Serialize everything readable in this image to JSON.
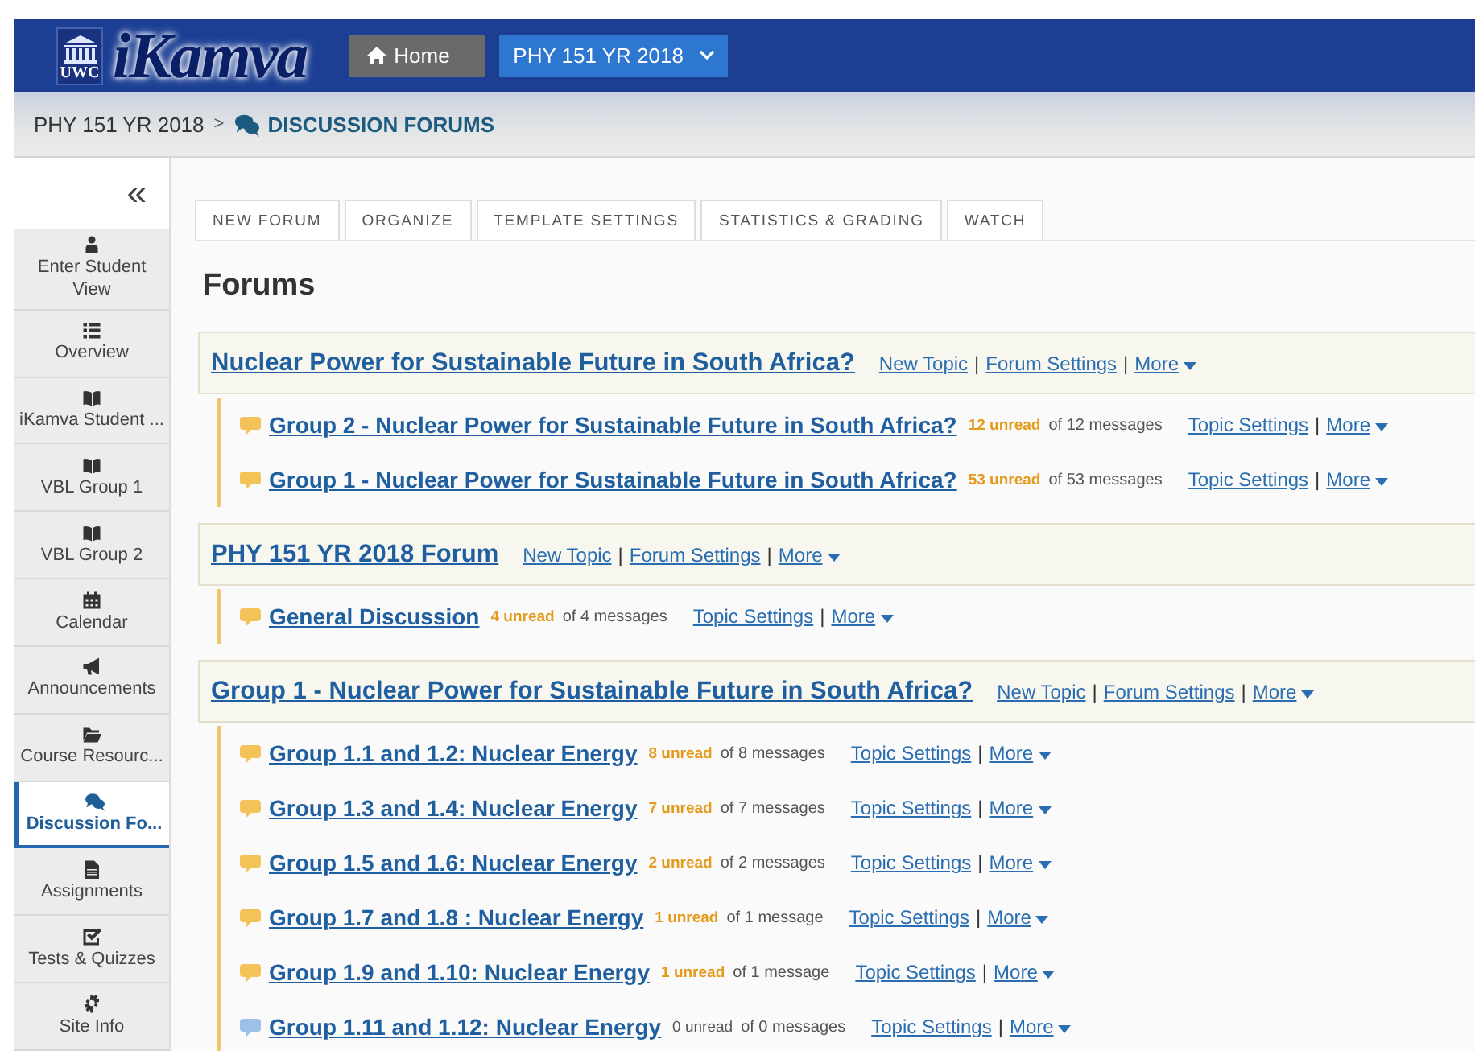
{
  "header": {
    "logo_badge": "UWC",
    "logo_text": "iKamva",
    "home_button": "Home",
    "site_selector": "PHY 151 YR 2018"
  },
  "breadcrumb": {
    "site": "PHY 151 YR 2018",
    "separator": ">",
    "page": "DISCUSSION FORUMS"
  },
  "sidebar": {
    "collapse": "«",
    "items": [
      {
        "label": "Enter Student View",
        "selected": false
      },
      {
        "label": "Overview",
        "selected": false
      },
      {
        "label": "iKamva Student ...",
        "selected": false
      },
      {
        "label": "VBL Group 1",
        "selected": false
      },
      {
        "label": "VBL Group 2",
        "selected": false
      },
      {
        "label": "Calendar",
        "selected": false
      },
      {
        "label": "Announcements",
        "selected": false
      },
      {
        "label": "Course Resourc...",
        "selected": false
      },
      {
        "label": "Discussion Fo...",
        "selected": true
      },
      {
        "label": "Assignments",
        "selected": false
      },
      {
        "label": "Tests & Quizzes",
        "selected": false
      },
      {
        "label": "Site Info",
        "selected": false
      }
    ]
  },
  "toolbar": [
    "NEW FORUM",
    "ORGANIZE",
    "TEMPLATE SETTINGS",
    "STATISTICS & GRADING",
    "WATCH"
  ],
  "heading": "Forums",
  "action_separator": "|",
  "forums": [
    {
      "title": "Nuclear Power for Sustainable Future in South Africa?",
      "actions": [
        "New Topic",
        "Forum Settings",
        "More"
      ],
      "topics": [
        {
          "title": "Group 2 - Nuclear Power for Sustainable Future in South Africa?",
          "unread": "12 unread",
          "total": "of 12 messages",
          "has_unread": true,
          "actions": [
            "Topic Settings",
            "More"
          ]
        },
        {
          "title": "Group 1 - Nuclear Power for Sustainable Future in South Africa?",
          "unread": "53 unread",
          "total": "of 53 messages",
          "has_unread": true,
          "actions": [
            "Topic Settings",
            "More"
          ]
        }
      ]
    },
    {
      "title": "PHY 151 YR 2018 Forum",
      "actions": [
        "New Topic",
        "Forum Settings",
        "More"
      ],
      "topics": [
        {
          "title": "General Discussion",
          "unread": "4 unread",
          "total": "of 4 messages",
          "has_unread": true,
          "actions": [
            "Topic Settings",
            "More"
          ]
        }
      ]
    },
    {
      "title": "Group 1 - Nuclear Power for Sustainable Future in South Africa?",
      "actions": [
        "New Topic",
        "Forum Settings",
        "More"
      ],
      "topics": [
        {
          "title": "Group 1.1 and 1.2: Nuclear Energy",
          "unread": "8 unread",
          "total": "of 8 messages",
          "has_unread": true,
          "actions": [
            "Topic Settings",
            "More"
          ]
        },
        {
          "title": "Group 1.3 and 1.4: Nuclear Energy",
          "unread": "7 unread",
          "total": "of 7 messages",
          "has_unread": true,
          "actions": [
            "Topic Settings",
            "More"
          ]
        },
        {
          "title": "Group 1.5 and 1.6: Nuclear Energy",
          "unread": "2 unread",
          "total": "of 2 messages",
          "has_unread": true,
          "actions": [
            "Topic Settings",
            "More"
          ]
        },
        {
          "title": "Group 1.7 and 1.8 : Nuclear Energy",
          "unread": "1 unread",
          "total": "of 1 message",
          "has_unread": true,
          "actions": [
            "Topic Settings",
            "More"
          ]
        },
        {
          "title": "Group 1.9 and 1.10: Nuclear Energy",
          "unread": "1 unread",
          "total": "of 1 message",
          "has_unread": true,
          "actions": [
            "Topic Settings",
            "More"
          ]
        },
        {
          "title": "Group 1.11 and 1.12: Nuclear Energy",
          "unread": "0 unread",
          "total": "of 0 messages",
          "has_unread": false,
          "actions": [
            "Topic Settings",
            "More"
          ]
        }
      ]
    }
  ]
}
